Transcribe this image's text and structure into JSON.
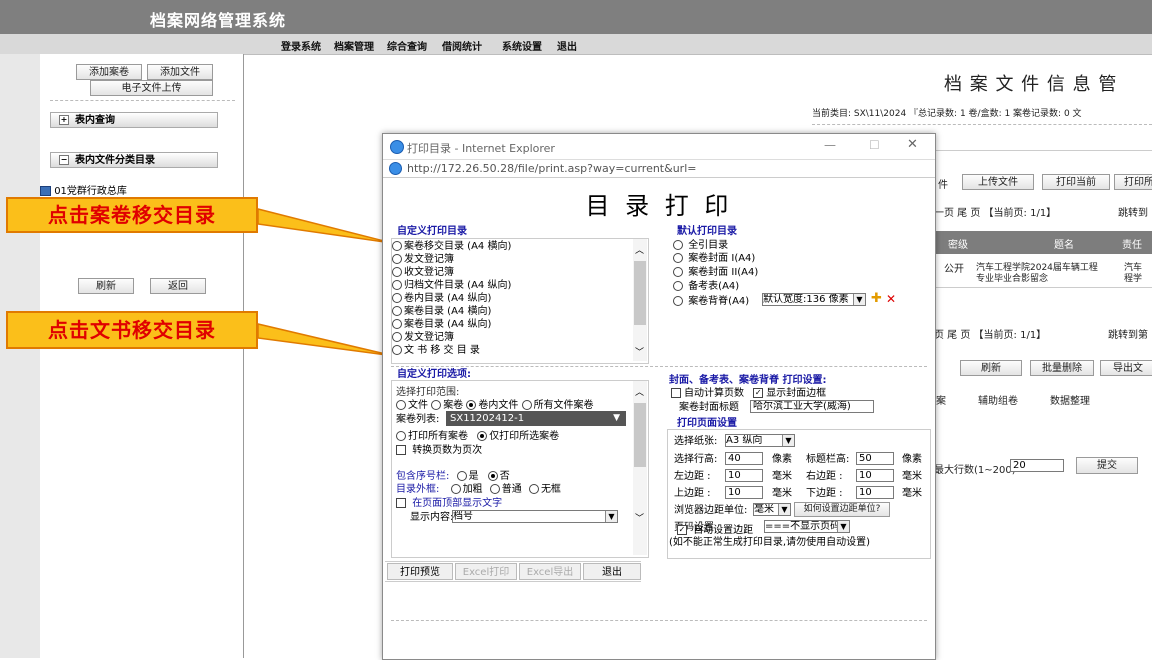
{
  "app": {
    "title": "档案网络管理系统"
  },
  "nav": [
    "登录系统",
    "档案管理",
    "综合查询",
    "借阅统计",
    "系统设置",
    "退出"
  ],
  "sidebar": {
    "add_archive": "添加案卷",
    "add_file": "添加文件",
    "e_upload": "电子文件上传",
    "table_query": "表内查询",
    "table_category": "表内文件分类目录",
    "tree_item": "01党群行政总库",
    "refresh": "刷新",
    "back": "返回"
  },
  "callouts": {
    "c1": "点击案卷移交目录",
    "c2": "点击文书移交目录"
  },
  "right": {
    "heading": "档 案 文 件 信 息 管",
    "info": "当前类目: SX\\11\\2024 『总记录数: 1 卷/盒数: 1 案卷记录数: 0 文",
    "t_file": "件",
    "t_upload": "上传文件",
    "t_print_cur": "打印当前",
    "t_print_all": "打印所",
    "pager1": "一页  尾 页  【当前页: 1/1】",
    "jump1": "跳转到",
    "col_secret": "密级",
    "col_title": "题名",
    "col_resp": "责任",
    "r_secret": "公开",
    "r_title_1": "汽车工程学院2024届车辆工程",
    "r_title_2": "专业毕业合影留念",
    "r_resp_1": "汽车",
    "r_resp_2": "程学",
    "pager2": "页  尾 页  【当前页: 1/1】",
    "jump2": "跳转到第",
    "refresh": "刷新",
    "batch_delete": "批量删除",
    "export": "导出文",
    "b_group": "辅助组卷",
    "b_organize": "数据整理",
    "b_frag": "案",
    "maxrows_label": "最大行数(1~200)",
    "maxrows_value": "20",
    "submit": "提交"
  },
  "dialog": {
    "title": "打印目录 - Internet Explorer",
    "url": "http://172.26.50.28/file/print.asp?way=current&url=",
    "heading": "目 录 打 印",
    "custom_list_title": "自定义打印目录",
    "custom_list": [
      "案卷移交目录 (A4 横向)",
      "发文登记簿",
      "收文登记簿",
      "归档文件目录 (A4 纵向)",
      "卷内目录 (A4 纵向)",
      "案卷目录 (A4 横向)",
      "案卷目录 (A4 纵向)",
      "发文登记簿",
      "文 书 移 交 目 录"
    ],
    "default_list_title": "默认打印目录",
    "default_list": [
      "全引目录",
      "案卷封面 I(A4)",
      "案卷封面 II(A4)",
      "备考表(A4)",
      "案卷背脊(A4)"
    ],
    "spine_width": "默认宽度:136 像素",
    "custom_opts_title": "自定义打印选项:",
    "range_label": "选择打印范围:",
    "range_opts": [
      "文件",
      "案卷",
      "卷内文件",
      "所有文件案卷"
    ],
    "range_selected": "卷内文件",
    "archive_list_label": "案卷列表:",
    "archive_list_value": "SX11202412-1",
    "print_all": "打印所有案卷",
    "print_selected": "仅打印所选案卷",
    "convert_pages": "转换页数为页次",
    "seq_col_label": "包含序号栏:",
    "yes": "是",
    "no": "否",
    "frame_label": "目录外框:",
    "frame_opts": [
      "加粗",
      "普通",
      "无框"
    ],
    "show_top_text": "在页面顶部显示文字",
    "display_content_label": "显示内容:",
    "display_content_value": "档号",
    "cover_settings_title": "封面、备考表、案卷背脊 打印设置:",
    "auto_calc_pages": "自动计算页数",
    "show_cover_border": "显示封面边框",
    "cover_title_label": "案卷封面标题",
    "cover_title_value": "哈尔滨工业大学(威海)",
    "page_setup_title": "打印页面设置",
    "paper_label": "选择纸张:",
    "paper_value": "A3 纵向",
    "row_height_label": "选择行高:",
    "row_height_value": "40",
    "px1": "像素",
    "title_height_label": "标题栏高:",
    "title_height_value": "50",
    "px2": "像素",
    "left_label": "左边距",
    "left_value": "10",
    "right_label": "右边距",
    "right_value": "10",
    "top_label": "上边距",
    "top_value": "10",
    "bottom_label": "下边距",
    "bottom_value": "10",
    "mm": "毫米",
    "unit_label": "浏览器边距单位:",
    "unit_value": "毫米",
    "how_set": "如何设置边距单位?",
    "page_num_label": "页码设置",
    "page_num_value": "===不显示页码===",
    "auto_margin": "自动设置边距",
    "auto_margin_note": "(如不能正常生成打印目录,请勿使用自动设置)",
    "btn_preview": "打印预览",
    "btn_excel_print": "Excel打印",
    "btn_excel_export": "Excel导出",
    "btn_exit": "退出"
  },
  "colors": {
    "accent_red": "#e00000",
    "callout_bg": "#fbbf1a",
    "link_blue": "#1a1aa6"
  }
}
